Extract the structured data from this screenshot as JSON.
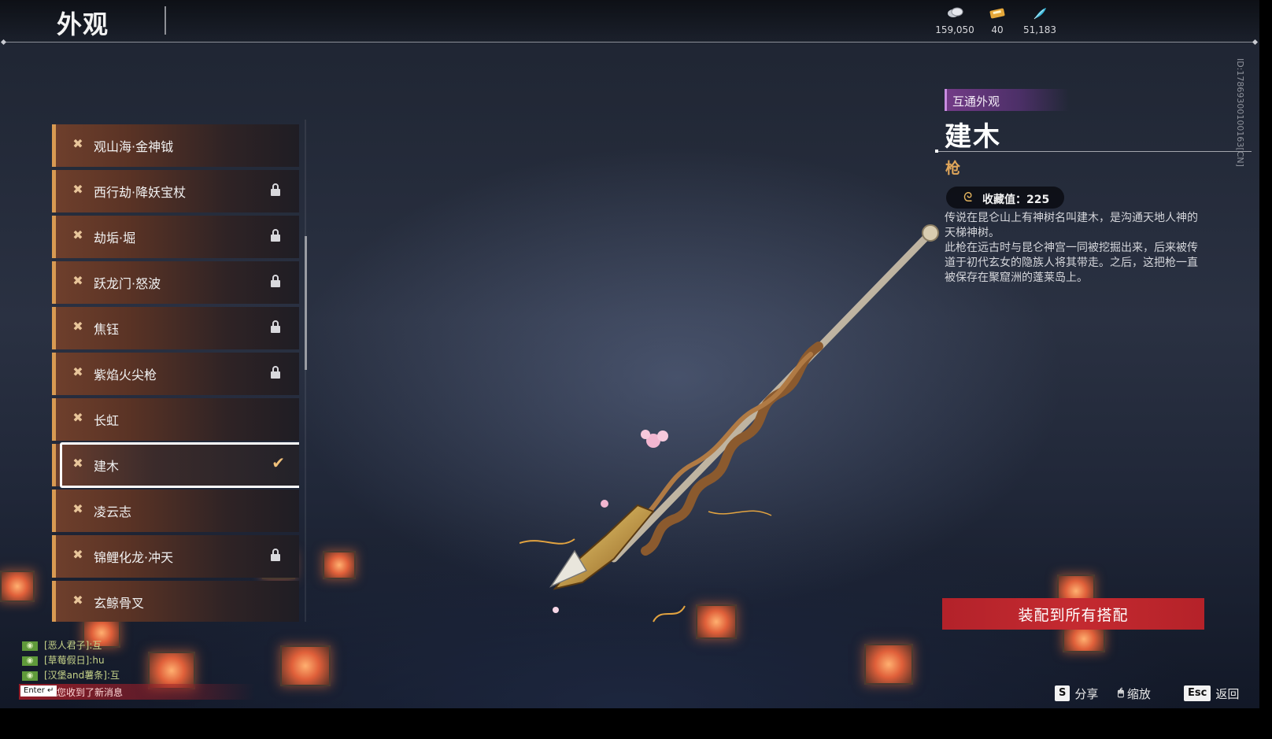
{
  "header": {
    "title": "外观",
    "currencies": [
      {
        "icon": "coin-icon",
        "value": "159,050"
      },
      {
        "icon": "ticket-icon",
        "value": "40"
      },
      {
        "icon": "feather-icon",
        "value": "51,183"
      }
    ]
  },
  "player_id": "ID:1786930010016​3[CN]",
  "list": {
    "items": [
      {
        "label": "观山海·金神钺",
        "locked": false
      },
      {
        "label": "西行劫·降妖宝杖",
        "locked": true
      },
      {
        "label": "劫垢·堀",
        "locked": true
      },
      {
        "label": "跃龙门·怒波",
        "locked": true
      },
      {
        "label": "焦钰",
        "locked": true
      },
      {
        "label": "紫焰火尖枪",
        "locked": true
      },
      {
        "label": "长虹",
        "locked": false
      },
      {
        "label": "建木",
        "locked": false,
        "selected": true
      },
      {
        "label": "凌云志",
        "locked": false
      },
      {
        "label": "锦鲤化龙·冲天",
        "locked": true
      },
      {
        "label": "玄鲸骨叉",
        "locked": false
      }
    ]
  },
  "detail": {
    "tag": "互通外观",
    "name": "建木",
    "type": "枪",
    "collect_label": "收藏值：225",
    "desc_1": "传说在昆仑山上有神树名叫建木，是沟通天地人神的天梯神树。",
    "desc_2": "此枪在远古时与昆仑神宫一同被挖掘出来，后来被传道于初代玄女的隐族人将其带走。之后，这把枪一直被保存在聚窟洲的蓬莱岛上。",
    "equip_button": "装配到所有搭配"
  },
  "hints": [
    {
      "key": "S",
      "label": "分享"
    },
    {
      "key": "🖱",
      "label": "缩放"
    },
    {
      "key": "Esc",
      "label": "返回"
    }
  ],
  "chat": [
    {
      "text": "[恶人君子]:互"
    },
    {
      "text": "[草莓假日]:hu"
    },
    {
      "text": "[汉堡and薯条]:互"
    }
  ],
  "notification": {
    "key": "Enter ↵",
    "message": "您收到了新消息"
  },
  "colors": {
    "accent_orange": "#d89a52",
    "equip_red": "#c42a30",
    "tag_purple": "#7a3c8c"
  }
}
